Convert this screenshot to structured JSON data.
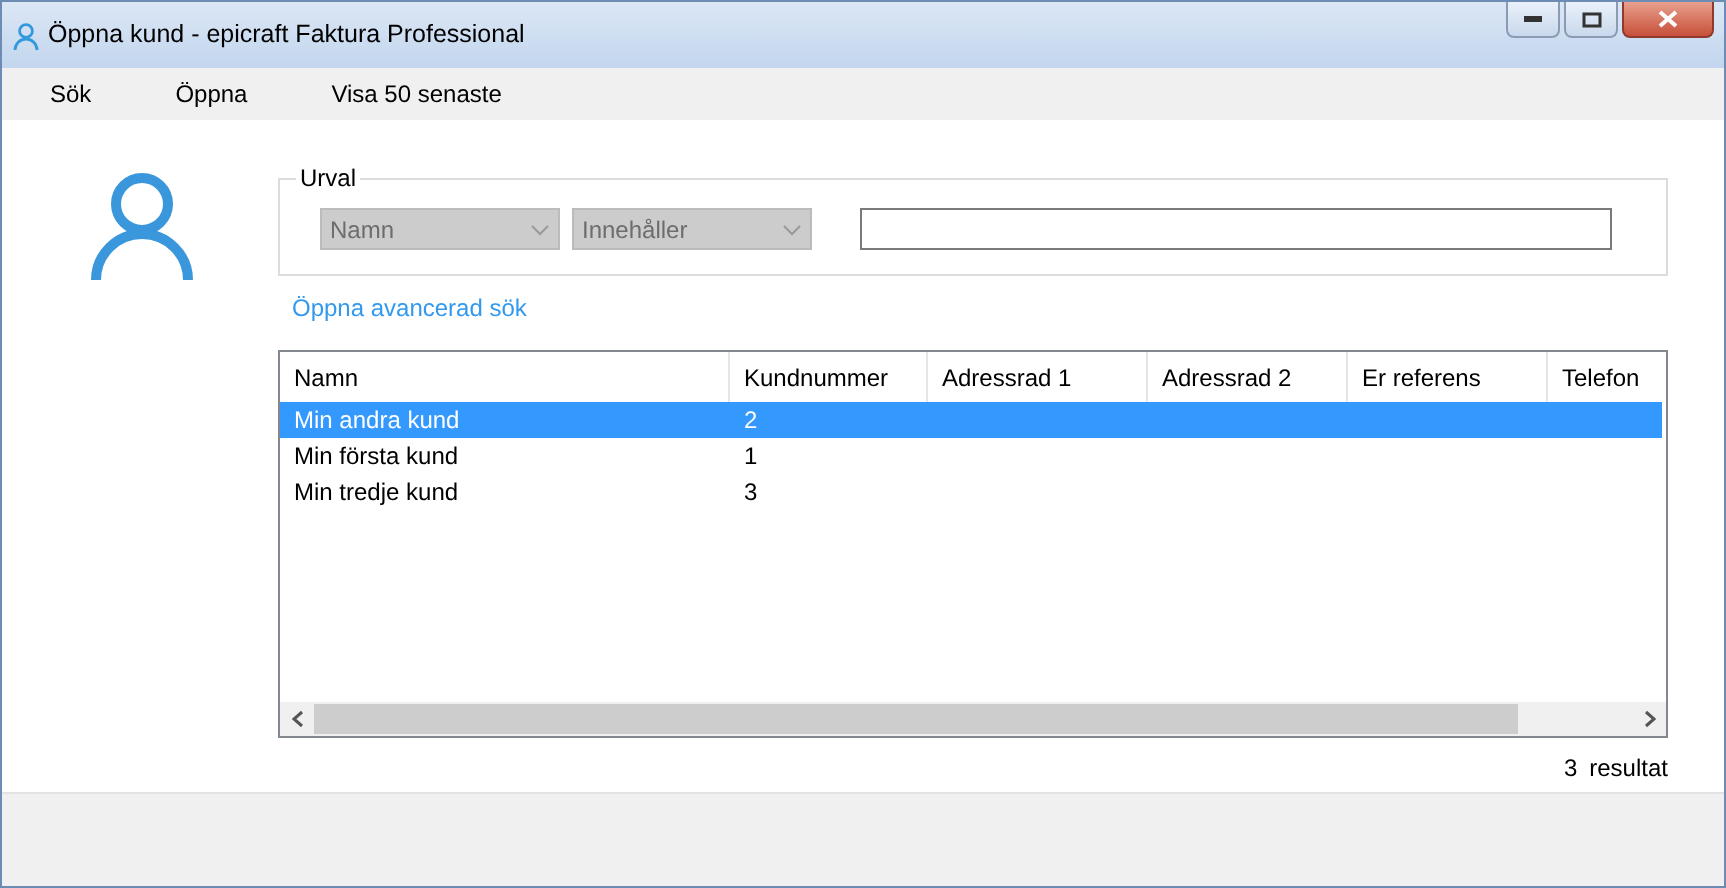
{
  "window": {
    "title": "Öppna kund - epicraft Faktura Professional"
  },
  "menu": [
    "Sök",
    "Öppna",
    "Visa 50 senaste"
  ],
  "filter": {
    "legend": "Urval",
    "dropdowns": [
      {
        "value": "Namn",
        "disabled": true
      },
      {
        "value": "Innehåller",
        "disabled": true
      }
    ]
  },
  "advanced_link": "Öppna avancerad sök",
  "table": {
    "columns": [
      "Namn",
      "Kundnummer",
      "Adressrad 1",
      "Adressrad 2",
      "Er referens",
      "Telefon"
    ],
    "rows": [
      {
        "cells": [
          "Min andra kund",
          "2"
        ],
        "selected": true
      },
      {
        "cells": [
          "Min första kund",
          "1"
        ],
        "selected": false
      },
      {
        "cells": [
          "Min tredje kund",
          "3"
        ],
        "selected": false
      }
    ]
  },
  "result": {
    "count": "3",
    "label": "resultat"
  }
}
